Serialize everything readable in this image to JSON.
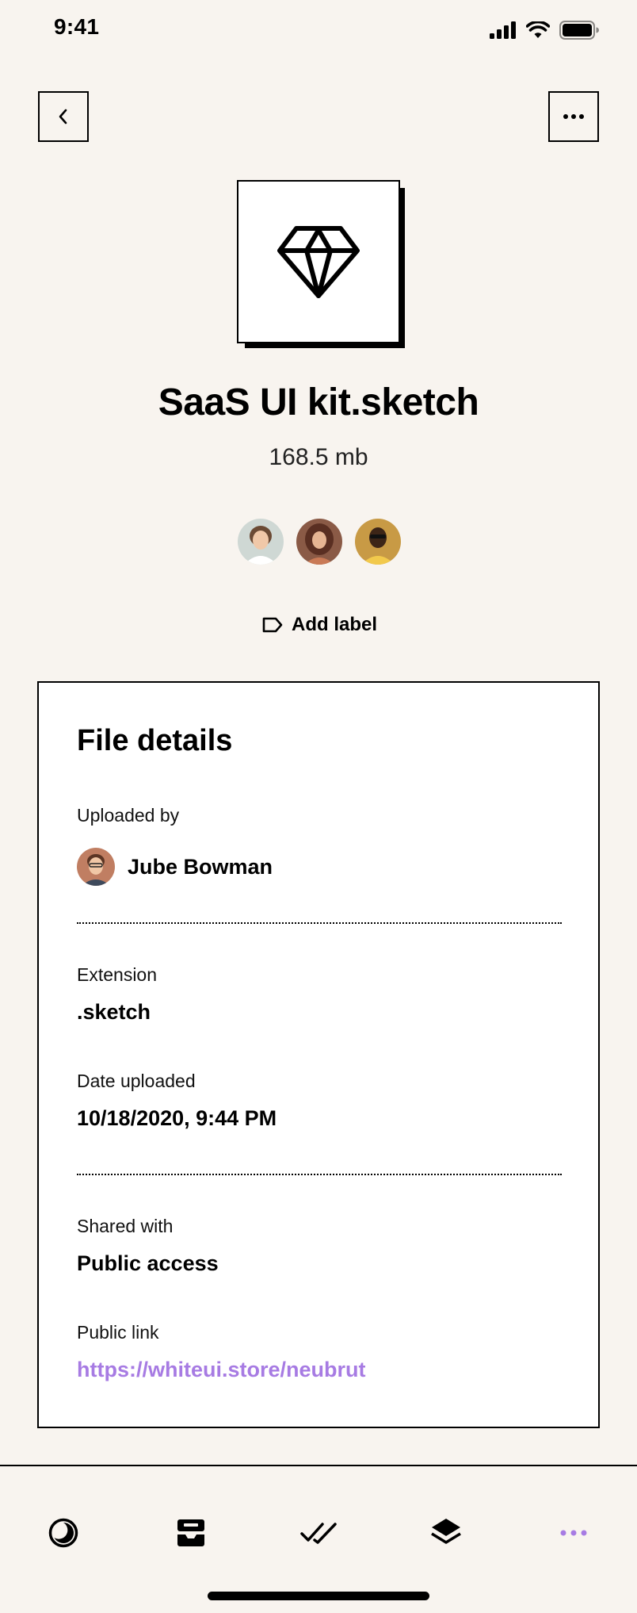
{
  "status_bar": {
    "time": "9:41"
  },
  "file": {
    "name": "SaaS UI kit.sketch",
    "size": "168.5 mb",
    "icon": "diamond-icon"
  },
  "collaborators": [
    {
      "name": "collaborator-1",
      "color": "#c9d3cf"
    },
    {
      "name": "collaborator-2",
      "color": "#a2664f"
    },
    {
      "name": "collaborator-3",
      "color": "#c89a45"
    }
  ],
  "add_label": {
    "label": "Add label",
    "icon": "tag-icon"
  },
  "details": {
    "title": "File details",
    "uploaded_by_label": "Uploaded by",
    "uploader_name": "Jube Bowman",
    "extension_label": "Extension",
    "extension_value": ".sketch",
    "date_label": "Date uploaded",
    "date_value": "10/18/2020, 9:44 PM",
    "shared_label": "Shared with",
    "shared_value": "Public access",
    "link_label": "Public link",
    "link_value": "https://whiteui.store/neubrut"
  },
  "tab_bar": {
    "items": [
      {
        "icon": "moon-icon"
      },
      {
        "icon": "inbox-icon"
      },
      {
        "icon": "double-check-icon"
      },
      {
        "icon": "layers-icon"
      },
      {
        "icon": "more-icon",
        "active": true
      }
    ],
    "active_color": "#a77be3"
  }
}
